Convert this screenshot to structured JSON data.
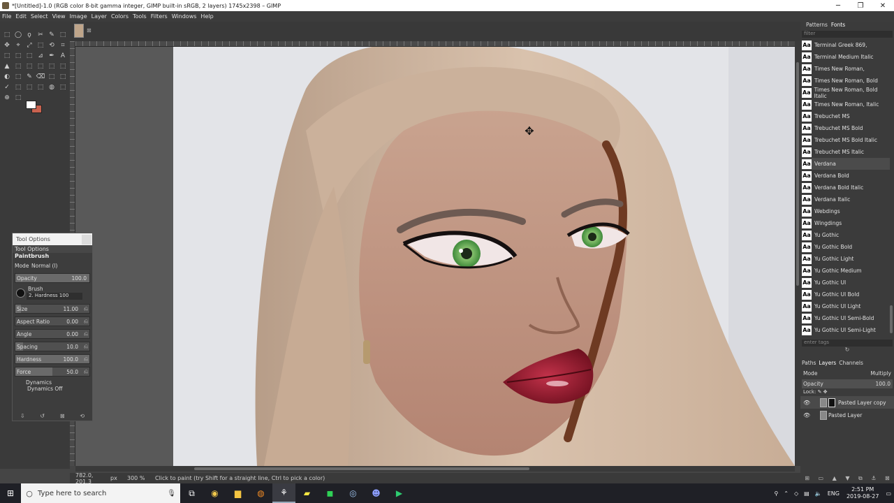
{
  "window": {
    "title": "*[Untitled]-1.0 (RGB color 8-bit gamma integer, GIMP built-in sRGB, 2 layers) 1745x2398 – GIMP",
    "minimize": "─",
    "maximize": "❐",
    "close": "✕"
  },
  "menu": [
    "File",
    "Edit",
    "Select",
    "View",
    "Image",
    "Layer",
    "Colors",
    "Tools",
    "Filters",
    "Windows",
    "Help"
  ],
  "tools": [
    "⬚",
    "◯",
    "ϙ",
    "✂",
    "✎",
    "⬚",
    "✥",
    "⌖",
    "⤢",
    "⬚",
    "⟲",
    "⌗",
    "⬚",
    "⬚",
    "⬚",
    "⊿",
    "✒",
    "A",
    "▲",
    "⬚",
    "⬚",
    "⬚",
    "⬚",
    "⬚",
    "◐",
    "⬚",
    "✎",
    "⌫",
    "⬚",
    "⬚",
    "✓",
    "⬚",
    "⬚",
    "⬚",
    "◍",
    "⬚",
    "⊕",
    "⬚"
  ],
  "colors": {
    "foreground": "#ffffff",
    "background": "#c9624f"
  },
  "image_tab": {
    "close": "⊠"
  },
  "status": {
    "coords": "782.0, 201.3",
    "unit": "px",
    "zoom": "300 %",
    "hint": "Click to paint (try Shift for a straight line, Ctrl to pick a color)"
  },
  "tool_options": {
    "window_title": "Tool Options",
    "tab": "Tool Options",
    "tool": "Paintbrush",
    "mode_label": "Mode",
    "mode_value": "Normal (l)",
    "opacity": {
      "label": "Opacity",
      "value": "100.0"
    },
    "brush_label": "Brush",
    "brush_name": "2. Hardness 100",
    "size": {
      "label": "Size",
      "value": "11.00"
    },
    "aspect": {
      "label": "Aspect Ratio",
      "value": "0.00"
    },
    "angle": {
      "label": "Angle",
      "value": "0.00"
    },
    "spacing": {
      "label": "Spacing",
      "value": "10.0"
    },
    "hardness": {
      "label": "Hardness",
      "value": "100.0"
    },
    "force": {
      "label": "Force",
      "value": "50.0"
    },
    "dynamics_label": "Dynamics",
    "dynamics_value": "Dynamics Off"
  },
  "fonts_panel": {
    "tabs": [
      "Patterns",
      "Fonts"
    ],
    "filter_placeholder": "filter",
    "fonts": [
      "Terminal Greek 869,",
      "Terminal Medium Italic",
      "Times New Roman,",
      "Times New Roman, Bold",
      "Times New Roman, Bold Italic",
      "Times New Roman, Italic",
      "Trebuchet MS",
      "Trebuchet MS Bold",
      "Trebuchet MS Bold Italic",
      "Trebuchet MS Italic",
      "Verdana",
      "Verdana Bold",
      "Verdana Bold Italic",
      "Verdana Italic",
      "Webdings",
      "Wingdings",
      "Yu Gothic",
      "Yu Gothic Bold",
      "Yu Gothic Light",
      "Yu Gothic Medium",
      "Yu Gothic UI",
      "Yu Gothic UI Bold",
      "Yu Gothic UI Light",
      "Yu Gothic UI Semi-Bold",
      "Yu Gothic UI Semi-Light"
    ],
    "aa_glyph": "Aa",
    "selected_font": "Verdana",
    "tags_placeholder": "enter tags"
  },
  "layers_panel": {
    "tabs": [
      "Paths",
      "Layers",
      "Channels"
    ],
    "mode_label": "Mode",
    "mode_value": "Multiply",
    "opacity_label": "Opacity",
    "opacity_value": "100.0",
    "lock_label": "Lock:",
    "layers": [
      "Pasted Layer copy",
      "Pasted Layer"
    ]
  },
  "taskbar": {
    "search_placeholder": "Type here to search",
    "time": "2:51 PM",
    "date": "2019-08-27",
    "lang": "ENG"
  }
}
